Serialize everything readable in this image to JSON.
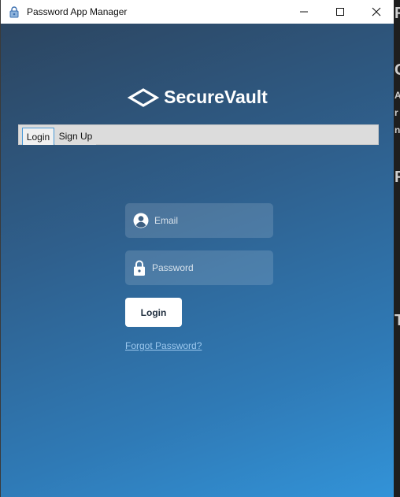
{
  "window": {
    "title": "Password App Manager"
  },
  "brand": {
    "name": "SecureVault"
  },
  "tabs": [
    {
      "label": "Login",
      "active": true
    },
    {
      "label": "Sign Up",
      "active": false
    }
  ],
  "form": {
    "email_placeholder": "Email",
    "password_placeholder": "Password",
    "login_label": "Login",
    "forgot_label": "Forgot Password?"
  },
  "icons": {
    "app": "lock-app-icon",
    "brand": "diamond-logo-icon",
    "email": "user-icon",
    "password": "lock-icon",
    "minimize": "minimize-icon",
    "maximize": "maximize-icon",
    "close": "close-icon"
  },
  "colors": {
    "gradient_start": "#2c4560",
    "gradient_end": "#3293d8",
    "link": "#9cc8ee"
  }
}
